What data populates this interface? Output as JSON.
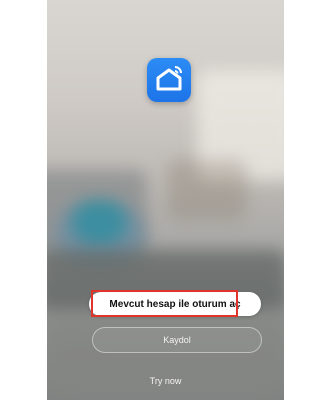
{
  "app_icon": {
    "name": "smart-home-icon",
    "color": "#1d74e8"
  },
  "buttons": {
    "login_label": "Mevcut hesap ile oturum aç",
    "register_label": "Kaydol",
    "try_now_label": "Try now"
  },
  "highlight_color": "#e0342a"
}
